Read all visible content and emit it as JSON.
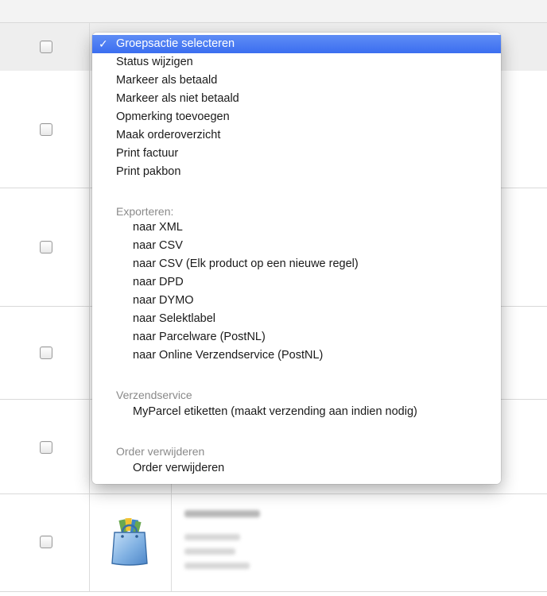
{
  "bulk_action_menu": {
    "selected": "Groepsactie selecteren",
    "check_mark": "✓",
    "actions": [
      "Status wijzigen",
      "Markeer als betaald",
      "Markeer als niet betaald",
      "Opmerking toevoegen",
      "Maak orderoverzicht",
      "Print factuur",
      "Print pakbon"
    ],
    "groups": {
      "export": {
        "label": "Exporteren:",
        "items": [
          "naar XML",
          "naar CSV",
          "naar CSV (Elk product op een nieuwe regel)",
          "naar DPD",
          "naar DYMO",
          "naar Selektlabel",
          "naar Parcelware (PostNL)",
          "naar Online Verzendservice (PostNL)"
        ]
      },
      "shipping": {
        "label": "Verzendservice",
        "items": [
          "MyParcel etiketten (maakt verzending aan indien nodig)"
        ]
      },
      "delete": {
        "label": "Order verwijderen",
        "items": [
          "Order verwijderen"
        ]
      }
    }
  },
  "icons": {
    "row_product": "shopping-bag-icon",
    "selected_marker": "checkmark-icon"
  }
}
